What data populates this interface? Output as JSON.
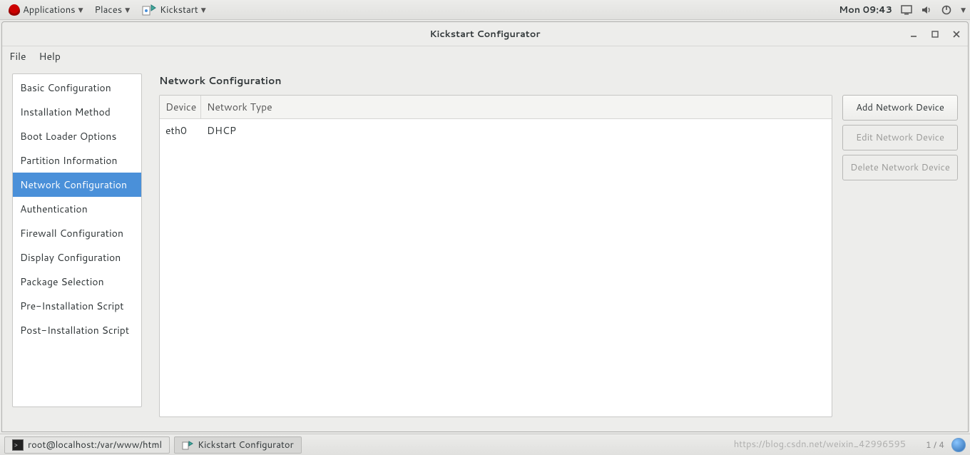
{
  "top_panel": {
    "applications": "Applications",
    "places": "Places",
    "app_launcher": "Kickstart",
    "clock": "Mon 09:43"
  },
  "window": {
    "title": "Kickstart Configurator",
    "menu": {
      "file": "File",
      "help": "Help"
    }
  },
  "sidebar": {
    "items": [
      "Basic Configuration",
      "Installation Method",
      "Boot Loader Options",
      "Partition Information",
      "Network Configuration",
      "Authentication",
      "Firewall Configuration",
      "Display Configuration",
      "Package Selection",
      "Pre-Installation Script",
      "Post-Installation Script"
    ],
    "selected_index": 4
  },
  "main": {
    "heading": "Network Configuration",
    "columns": {
      "device": "Device",
      "nettype": "Network Type"
    },
    "rows": [
      {
        "device": "eth0",
        "nettype": "DHCP"
      }
    ],
    "buttons": {
      "add": "Add Network Device",
      "edit": "Edit Network Device",
      "delete": "Delete Network Device"
    }
  },
  "taskbar": {
    "terminal": "root@localhost:/var/www/html",
    "app": "Kickstart Configurator",
    "pager": "1 / 4",
    "watermark": "https://blog.csdn.net/weixin_42996595"
  }
}
